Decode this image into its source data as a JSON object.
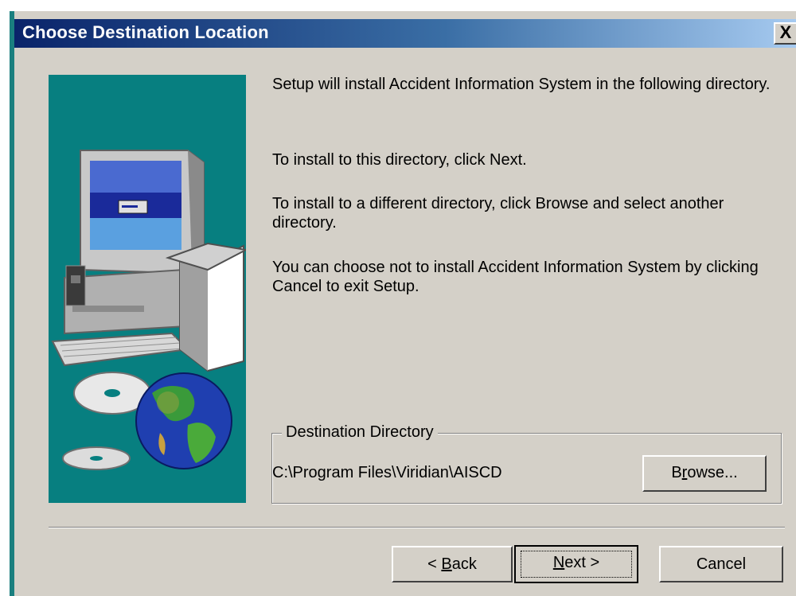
{
  "window": {
    "title": "Choose Destination Location",
    "close_label": "X"
  },
  "body": {
    "para1": "Setup will install Accident Information System in the following directory.",
    "para2": "To install to this directory, click Next.",
    "para3": "To install to a different directory, click Browse and select another directory.",
    "para4": "You can choose not to install Accident Information System by clicking Cancel to exit Setup."
  },
  "destination": {
    "group_label": "Destination Directory",
    "path": "C:\\Program Files\\Viridian\\AISCD",
    "browse_pre": "B",
    "browse_mnemonic": "r",
    "browse_post": "owse..."
  },
  "buttons": {
    "back_pre": "< ",
    "back_mnemonic": "B",
    "back_post": "ack",
    "next_mnemonic": "N",
    "next_post": "ext >",
    "cancel": "Cancel"
  },
  "colors": {
    "title_gradient_start": "#0a246a",
    "title_gradient_end": "#a6caf0",
    "dialog_face": "#d4d0c8",
    "art_background": "#077f80"
  },
  "icons": [
    "computer-illustration",
    "cd-discs-illustration",
    "globe-illustration",
    "close-icon"
  ]
}
